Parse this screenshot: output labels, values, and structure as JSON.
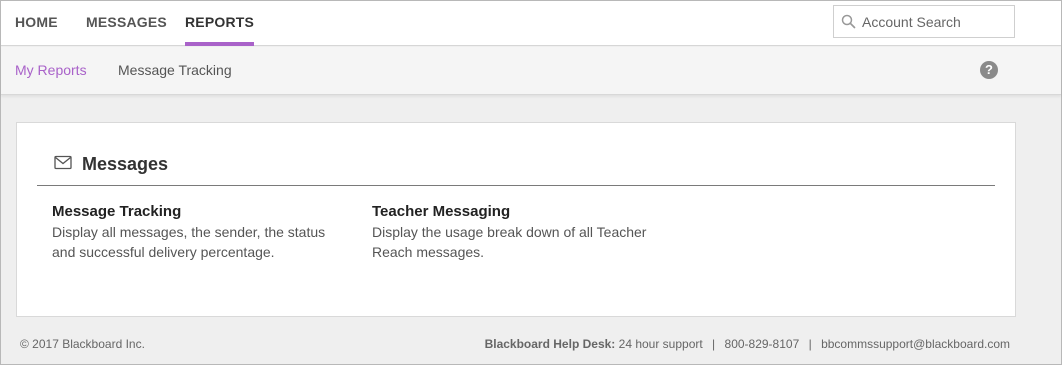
{
  "topnav": {
    "items": [
      {
        "label": "HOME"
      },
      {
        "label": "MESSAGES"
      },
      {
        "label": "REPORTS",
        "active": true
      }
    ],
    "search": {
      "placeholder": "Account Search"
    },
    "accent": "#a962c9"
  },
  "subnav": {
    "items": [
      {
        "label": "My Reports",
        "active": true
      },
      {
        "label": "Message Tracking"
      }
    ],
    "help_icon": "?"
  },
  "card": {
    "title": "Messages",
    "icon": "envelope-icon",
    "reports": [
      {
        "title": "Message Tracking",
        "description": "Display all messages, the sender, the status and successful delivery percentage."
      },
      {
        "title": "Teacher Messaging",
        "description": "Display the usage break down of all Teacher Reach messages."
      }
    ]
  },
  "footer": {
    "copyright": "© 2017 Blackboard Inc.",
    "helpdesk_label": "Blackboard Help Desk:",
    "helpdesk_hours": "24 hour support",
    "phone": "800-829-8107",
    "email": "bbcommssupport@blackboard.com",
    "separator": "|"
  }
}
